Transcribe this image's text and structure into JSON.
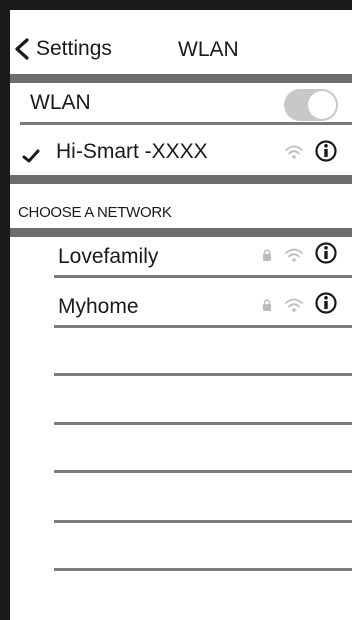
{
  "navbar": {
    "back_label": "Settings",
    "title": "WLAN"
  },
  "wlan_toggle": {
    "label": "WLAN",
    "state": "on"
  },
  "connected_network": {
    "name": "Hi-Smart -XXXX",
    "status": "connected",
    "secured": false
  },
  "networks_section": {
    "header": "CHOOSE A NETWORK",
    "items": [
      {
        "name": "Lovefamily",
        "secured": true
      },
      {
        "name": "Myhome",
        "secured": true
      }
    ]
  },
  "colors": {
    "separator": "#6d6d6d",
    "toggle": "#c8c8c8",
    "frame": "#1a1a1a"
  },
  "icons": [
    "chevron-left-icon",
    "checkmark-icon",
    "wifi-icon",
    "lock-icon",
    "info-icon"
  ]
}
